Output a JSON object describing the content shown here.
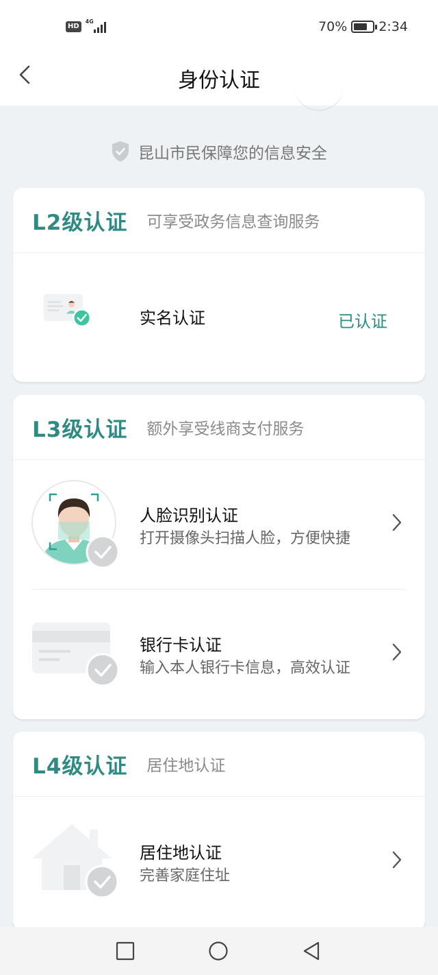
{
  "status_bar": {
    "hd": "HD",
    "network": "4G",
    "signal_level": 4,
    "battery_percent": "70%",
    "battery_level": 0.7,
    "time": "2:34"
  },
  "header": {
    "title": "身份认证"
  },
  "security_note": "昆山市民保障您的信息安全",
  "accent_color": "#2e8a82",
  "sections": [
    {
      "level": "L2级认证",
      "description": "可享受政务信息查询服务",
      "items": [
        {
          "title": "实名认证",
          "status": "已认证",
          "icon": "id-card-verified-icon"
        }
      ]
    },
    {
      "level": "L3级认证",
      "description": "额外享受线商支付服务",
      "items": [
        {
          "title": "人脸识别认证",
          "subtitle": "打开摄像头扫描人脸，方便快捷",
          "icon": "face-scan-icon"
        },
        {
          "title": "银行卡认证",
          "subtitle": "输入本人银行卡信息，高效认证",
          "icon": "bank-card-icon"
        }
      ]
    },
    {
      "level": "L4级认证",
      "description": "居住地认证",
      "items": [
        {
          "title": "居住地认证",
          "subtitle": "完善家庭住址",
          "icon": "house-icon"
        }
      ]
    }
  ],
  "system_nav": {
    "recents": "square-icon",
    "home": "circle-icon",
    "back": "triangle-back-icon"
  }
}
